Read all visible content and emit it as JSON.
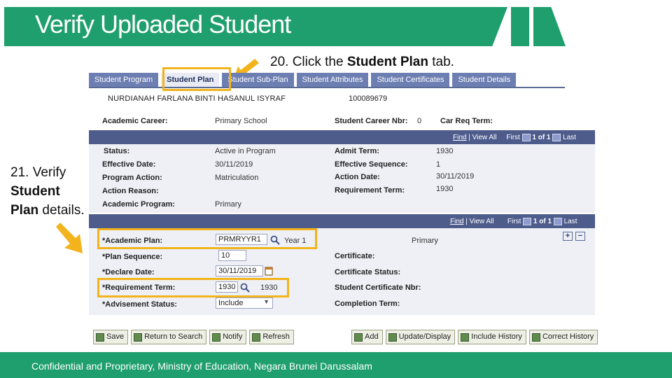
{
  "slide": {
    "title": "Verify Uploaded Student",
    "instruction_20_prefix": "20. Click the ",
    "instruction_20_bold": "Student Plan",
    "instruction_20_suffix": " tab.",
    "instruction_21_line1": "21. Verify",
    "instruction_21_line2": "Student",
    "instruction_21_line3_bold": "Plan",
    "instruction_21_line3_rest": " details.",
    "footer": "Confidential and Proprietary, Ministry of Education, Negara Brunei Darussalam",
    "accent_color": "#1f9f6e",
    "highlight_color": "#f2b31c"
  },
  "tabs": [
    {
      "label": "Student Program",
      "active": false
    },
    {
      "label": "Student Plan",
      "active": true
    },
    {
      "label": "Student Sub-Plan",
      "active": false
    },
    {
      "label": "Student Attributes",
      "active": false
    },
    {
      "label": "Student Certificates",
      "active": false
    },
    {
      "label": "Student Details",
      "active": false
    }
  ],
  "student": {
    "name": "NURDIANAH FARLANA BINTI HASANUL ISYRAF",
    "id": "100089679"
  },
  "career": {
    "academic_career_label": "Academic Career:",
    "academic_career_value": "Primary School",
    "career_nbr_label": "Student Career Nbr:",
    "career_nbr_value": "0",
    "car_req_term_label": "Car Req Term:"
  },
  "program_nav": {
    "find": "Find",
    "view_all": "View All",
    "first": "First",
    "count": "1 of 1",
    "last": "Last"
  },
  "program": {
    "status_label": "Status:",
    "status_value": "Active in Program",
    "effective_date_label": "Effective Date:",
    "effective_date_value": "30/11/2019",
    "program_action_label": "Program Action:",
    "program_action_value": "Matriculation",
    "action_reason_label": "Action Reason:",
    "academic_program_label": "Academic Program:",
    "academic_program_value": "Primary",
    "admit_term_label": "Admit Term:",
    "admit_term_value": "1930",
    "eff_seq_label": "Effective Sequence:",
    "eff_seq_value": "1",
    "action_date_label": "Action Date:",
    "action_date_value": "30/11/2019",
    "req_term_label": "Requirement Term:",
    "req_term_value": "1930"
  },
  "plan_nav": {
    "find": "Find",
    "view_all": "View All",
    "first": "First",
    "count": "1 of 1",
    "last": "Last"
  },
  "plan": {
    "academic_plan_label": "*Academic Plan:",
    "academic_plan_value": "PRMRYYR1",
    "academic_plan_desc": "Year 1",
    "plan_program": "Primary",
    "plan_sequence_label": "*Plan Sequence:",
    "plan_sequence_value": "10",
    "declare_date_label": "*Declare Date:",
    "declare_date_value": "30/11/2019",
    "requirement_term_label": "*Requirement Term:",
    "requirement_term_value": "1930",
    "requirement_term_desc": "1930",
    "advisement_status_label": "*Advisement Status:",
    "advisement_status_value": "Include",
    "certificate_label": "Certificate:",
    "certificate_status_label": "Certificate Status:",
    "student_cert_nbr_label": "Student Certificate Nbr:",
    "completion_term_label": "Completion Term:",
    "plus": "+",
    "minus": "−"
  },
  "buttons": {
    "save": "Save",
    "return_to_search": "Return to Search",
    "notify": "Notify",
    "refresh": "Refresh",
    "add": "Add",
    "update_display": "Update/Display",
    "include_history": "Include History",
    "correct_history": "Correct History"
  }
}
